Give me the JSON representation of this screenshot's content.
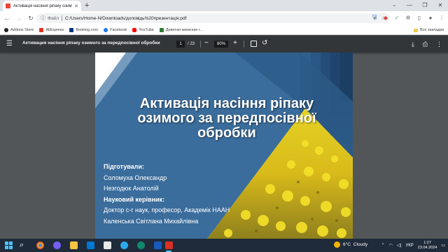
{
  "browser": {
    "tab_title": "Активація насіння ріпаку озим",
    "new_tab": "+",
    "url_scheme": "Файл",
    "url": "C:/Users/Home-N/Downloads/доповідь%20презентація.pdf"
  },
  "bookmarks": {
    "items": [
      {
        "label": "Addons Store",
        "color": "#222222"
      },
      {
        "label": "AliExpress",
        "color": "#e43225"
      },
      {
        "label": "Booking.com",
        "color": "#003580"
      },
      {
        "label": "Facebook",
        "color": "#1877f2"
      },
      {
        "label": "YouTube",
        "color": "#ff0000"
      },
      {
        "label": "Девятая киевская г...",
        "color": "#2e7d32"
      }
    ],
    "all_label": "Все закладки"
  },
  "pdf": {
    "title": "Активация насіння ріпаку озимого за передпосівної обробки",
    "page_current": "1",
    "page_total": "/ 23",
    "zoom": "80%"
  },
  "slide": {
    "title": "Активація насіння ріпаку озимого за передпосівної обробки",
    "prepared_label": "Підготували:",
    "authors": [
      "Соломуха Олександр",
      "Незгодюк Анатолій"
    ],
    "supervisor_label": "Науковий керівник:",
    "supervisor_title": "Доктор с-г наук, професор, Академік НААН",
    "supervisor_name": "Каленська Світлана Михайлівна"
  },
  "taskbar": {
    "temperature": "6°C",
    "weather": "Cloudy",
    "language": "УКР",
    "time": "1:27",
    "date": "23.04.2024"
  }
}
